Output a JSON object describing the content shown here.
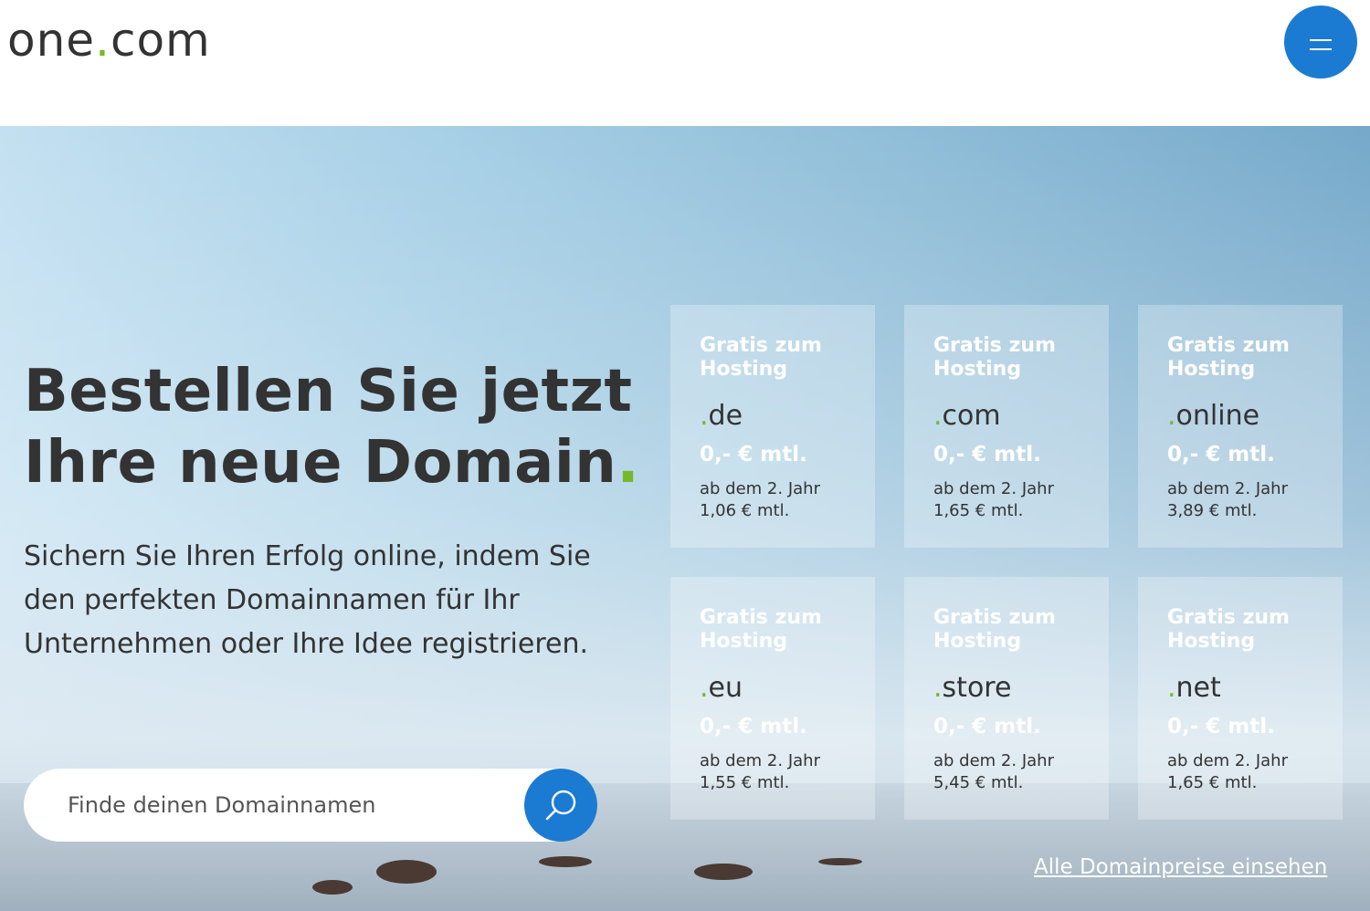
{
  "header": {
    "logo_text_main": "one",
    "logo_dot": ".",
    "logo_text_end": "com",
    "menu_label": "menu-icon"
  },
  "hero": {
    "headline_line1": "Bestellen Sie jetzt",
    "headline_line2": "Ihre neue Domain",
    "headline_dot": ".",
    "subtext": "Sichern Sie Ihren Erfolg online, indem Sie den perfekten Domainnamen für Ihr Unternehmen oder Ihre Idee registrieren.",
    "search_placeholder": "Finde deinen Domainnamen",
    "search_icon": "search-icon",
    "all_prices_link": "Alle Domainpreise einsehen"
  },
  "domains": [
    {
      "promo": "Gratis zum Hosting",
      "tld": "de",
      "price": "0,- € mtl.",
      "renew_label": "ab dem 2. Jahr",
      "renew_price": "1,06 € mtl."
    },
    {
      "promo": "Gratis zum Hosting",
      "tld": "com",
      "price": "0,- € mtl.",
      "renew_label": "ab dem 2. Jahr",
      "renew_price": "1,65 € mtl."
    },
    {
      "promo": "Gratis zum Hosting",
      "tld": "online",
      "price": "0,- € mtl.",
      "renew_label": "ab dem 2. Jahr",
      "renew_price": "3,89 € mtl."
    },
    {
      "promo": "Gratis zum Hosting",
      "tld": "eu",
      "price": "0,- € mtl.",
      "renew_label": "ab dem 2. Jahr",
      "renew_price": "1,55 € mtl."
    },
    {
      "promo": "Gratis zum Hosting",
      "tld": "store",
      "price": "0,- € mtl.",
      "renew_label": "ab dem 2. Jahr",
      "renew_price": "5,45 € mtl."
    },
    {
      "promo": "Gratis zum Hosting",
      "tld": "net",
      "price": "0,- € mtl.",
      "renew_label": "ab dem 2. Jahr",
      "renew_price": "1,65 € mtl."
    }
  ],
  "colors": {
    "brand_blue": "#1b7bd2",
    "brand_green": "#76b82a",
    "text_dark": "#333333"
  }
}
